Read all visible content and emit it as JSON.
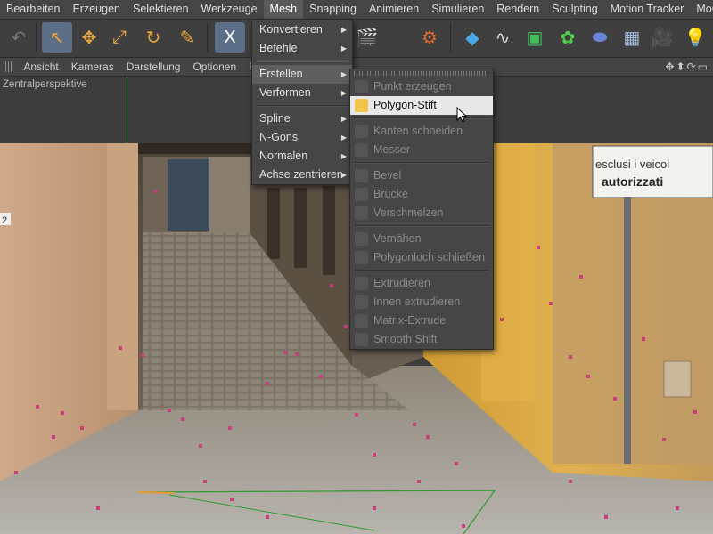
{
  "menubar": {
    "items": [
      "Bearbeiten",
      "Erzeugen",
      "Selektieren",
      "Werkzeuge",
      "Mesh",
      "Snapping",
      "Animieren",
      "Simulieren",
      "Rendern",
      "Sculpting",
      "Motion Tracker",
      "MoGraph"
    ],
    "active": "Mesh"
  },
  "toolbar": {
    "buttons": [
      {
        "icon": "undo-icon",
        "glyph": "↶"
      },
      {
        "icon": "select-arrow-icon",
        "glyph": "↖"
      },
      {
        "icon": "move-icon",
        "glyph": "✥"
      },
      {
        "icon": "scale-icon",
        "glyph": "⤢"
      },
      {
        "icon": "rotate-icon",
        "glyph": "↻"
      },
      {
        "icon": "tool-icon",
        "glyph": "✎"
      },
      {
        "icon": "x-axis-icon",
        "glyph": "X"
      },
      {
        "icon": "render-view-icon",
        "glyph": "🎬"
      },
      {
        "icon": "render-settings-icon",
        "glyph": "⚙"
      },
      {
        "icon": "cube-icon",
        "glyph": "◆"
      },
      {
        "icon": "spline-icon",
        "glyph": "∿"
      },
      {
        "icon": "subdivision-icon",
        "glyph": "▣"
      },
      {
        "icon": "mograph-cloner-icon",
        "glyph": "✿"
      },
      {
        "icon": "deformer-icon",
        "glyph": "⬬"
      },
      {
        "icon": "floor-icon",
        "glyph": "▦"
      },
      {
        "icon": "camera-icon",
        "glyph": "🎥"
      },
      {
        "icon": "light-icon",
        "glyph": "💡"
      }
    ]
  },
  "viewbar": {
    "items": [
      "Ansicht",
      "Kameras",
      "Darstellung",
      "Optionen",
      "F"
    ],
    "nav": "✥⬍⟳▭"
  },
  "viewport": {
    "title": "Zentralperspektive"
  },
  "mesh_menu": {
    "items": [
      {
        "label": "Konvertieren",
        "submenu": true
      },
      {
        "label": "Befehle",
        "submenu": true
      },
      {
        "sep": true
      },
      {
        "label": "Erstellen",
        "submenu": true,
        "selected": true
      },
      {
        "label": "Verformen",
        "submenu": true
      },
      {
        "sep": true
      },
      {
        "label": "Spline",
        "submenu": true
      },
      {
        "label": "N-Gons",
        "submenu": true
      },
      {
        "label": "Normalen",
        "submenu": true
      },
      {
        "label": "Achse zentrieren",
        "submenu": true
      }
    ]
  },
  "create_menu": {
    "items": [
      {
        "label": "Punkt erzeugen",
        "icon": "point-create-icon",
        "disabled": true
      },
      {
        "label": "Polygon-Stift",
        "icon": "polygon-pen-icon",
        "highlighted": true
      },
      {
        "sep": true
      },
      {
        "label": "Kanten schneiden",
        "icon": "edge-cut-icon",
        "disabled": true
      },
      {
        "label": "Messer",
        "icon": "knife-icon",
        "disabled": true
      },
      {
        "sep": true
      },
      {
        "label": "Bevel",
        "icon": "bevel-icon",
        "disabled": true
      },
      {
        "label": "Brücke",
        "icon": "bridge-icon",
        "disabled": true
      },
      {
        "label": "Verschmelzen",
        "icon": "melt-icon",
        "disabled": true
      },
      {
        "sep": true
      },
      {
        "label": "Vernähen",
        "icon": "stitch-icon",
        "disabled": true
      },
      {
        "label": "Polygonloch schließen",
        "icon": "close-hole-icon",
        "disabled": true
      },
      {
        "sep": true
      },
      {
        "label": "Extrudieren",
        "icon": "extrude-icon",
        "disabled": true
      },
      {
        "label": "Innen extrudieren",
        "icon": "extrude-inner-icon",
        "disabled": true
      },
      {
        "label": "Matrix-Extrude",
        "icon": "matrix-extrude-icon",
        "disabled": true
      },
      {
        "label": "Smooth Shift",
        "icon": "smooth-shift-icon",
        "disabled": true
      }
    ]
  },
  "scene": {
    "sign_line1": "esclusi i veicol",
    "sign_line2": "autorizzati",
    "house_number": "2"
  },
  "colors": {
    "accent_selected": "#5d6f86",
    "wall_yellow": "#d9a640",
    "guide_green": "#2f9a2f",
    "point_marker": "#c8407a"
  }
}
